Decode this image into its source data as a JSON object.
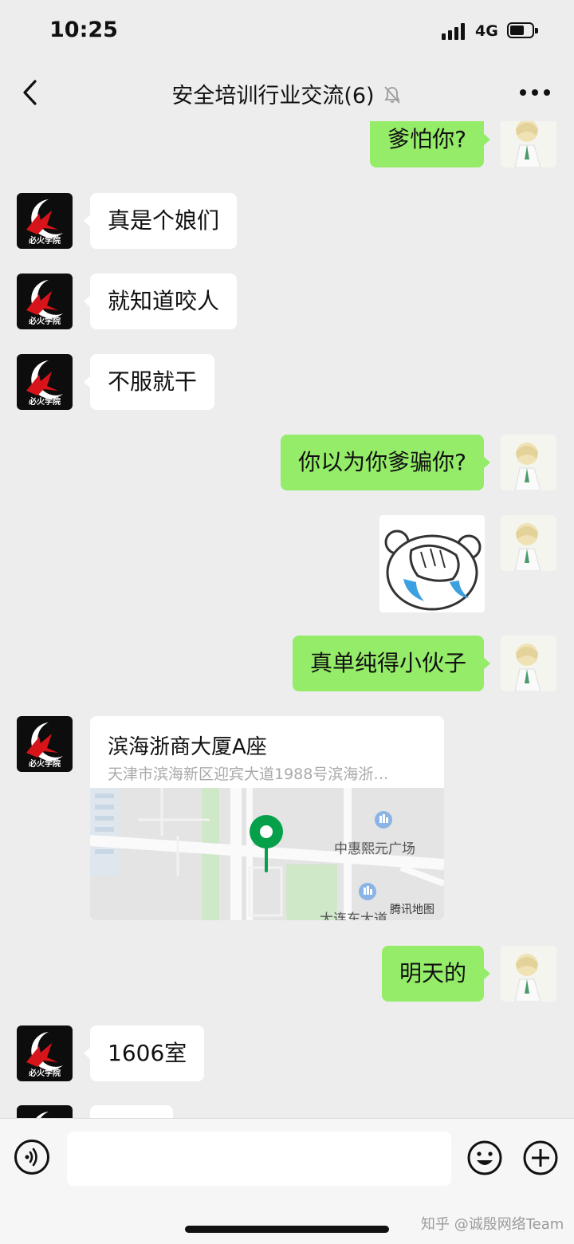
{
  "status_bar": {
    "time": "10:25",
    "network": "4G"
  },
  "header": {
    "title": "安全培训行业交流(6)",
    "muted": true
  },
  "brand_avatar_text": "必火学院",
  "messages": [
    {
      "side": "right",
      "text": "爹怕你?"
    },
    {
      "side": "left",
      "text": "真是个娘们"
    },
    {
      "side": "left",
      "text": "就知道咬人"
    },
    {
      "side": "left",
      "text": "不服就干"
    },
    {
      "side": "right",
      "text": "你以为你爹骗你?"
    },
    {
      "side": "right",
      "type": "sticker",
      "sticker": "crying-bear-face-palm"
    },
    {
      "side": "right",
      "text": "真单纯得小伙子"
    },
    {
      "side": "left",
      "type": "location"
    },
    {
      "side": "right",
      "text": "明天的"
    },
    {
      "side": "left",
      "text": "1606室"
    }
  ],
  "location": {
    "name": "滨海浙商大厦A座",
    "address": "天津市滨海新区迎宾大道1988号滨海浙…",
    "map_poi": "中惠熙元广场",
    "map_road": "大连东大道",
    "map_credit": "腾讯地图"
  },
  "watermark": "知乎 @诚殷网络Team",
  "colors": {
    "background": "#ededed",
    "sent_bubble": "#95ec69",
    "received_bubble": "#ffffff",
    "map_pin": "#07a04a"
  }
}
